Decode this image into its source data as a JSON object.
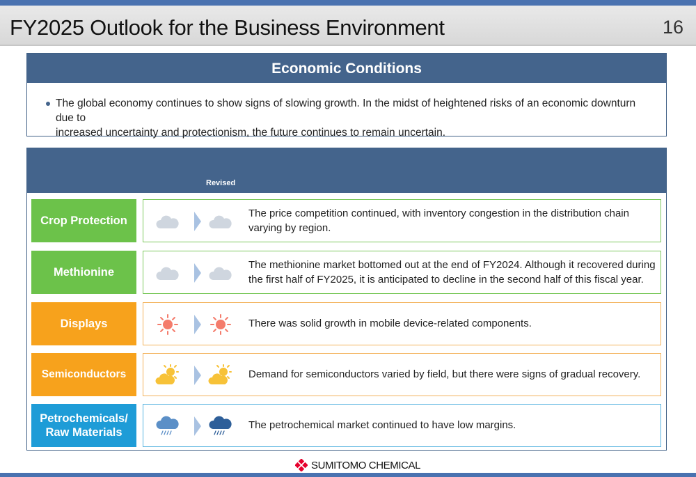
{
  "page": {
    "title": "FY2025 Outlook for the Business Environment",
    "page_number": "16"
  },
  "economic_conditions": {
    "heading": "Economic Conditions",
    "bullet_text": "The global economy continues to show signs of slowing growth. In the midst of heightened risks of an economic downturn due to\nincreased uncertainty and protectionism, the future continues to remain uncertain."
  },
  "segments_table": {
    "revised_label": "Revised",
    "rows": [
      {
        "label": "Crop Protection",
        "before_icon": "cloud-icon",
        "after_icon": "cloud-icon",
        "description": "The price competition continued, with inventory congestion in the distribution chain\nvarying by region."
      },
      {
        "label": "Methionine",
        "before_icon": "cloud-icon",
        "after_icon": "cloud-icon",
        "description": "The methionine market bottomed out at the end of FY2024. Although it recovered during\nthe first half of FY2025, it is anticipated to decline in the second half of this fiscal year."
      },
      {
        "label": "Displays",
        "before_icon": "sun-icon",
        "after_icon": "sun-icon",
        "description": "There was solid growth in mobile device-related components."
      },
      {
        "label": "Semiconductors",
        "before_icon": "partly-cloudy-icon",
        "after_icon": "partly-cloudy-icon",
        "description": "Demand for semiconductors varied by field, but there were signs of gradual recovery."
      },
      {
        "label": "Petrochemicals/\nRaw Materials",
        "before_icon": "rain-cloud-light-icon",
        "after_icon": "rain-cloud-dark-icon",
        "description": "The petrochemical market continued to have low margins."
      }
    ]
  },
  "footer": {
    "logo_text": "SUMITOMO CHEMICAL",
    "logo_icon": "sumitomo-diamond-logo"
  },
  "colors": {
    "header_blue": "#44648c",
    "green": "#6cc24a",
    "orange": "#f7a21c",
    "blue": "#1e9cd7",
    "logo_red": "#e6002d"
  }
}
